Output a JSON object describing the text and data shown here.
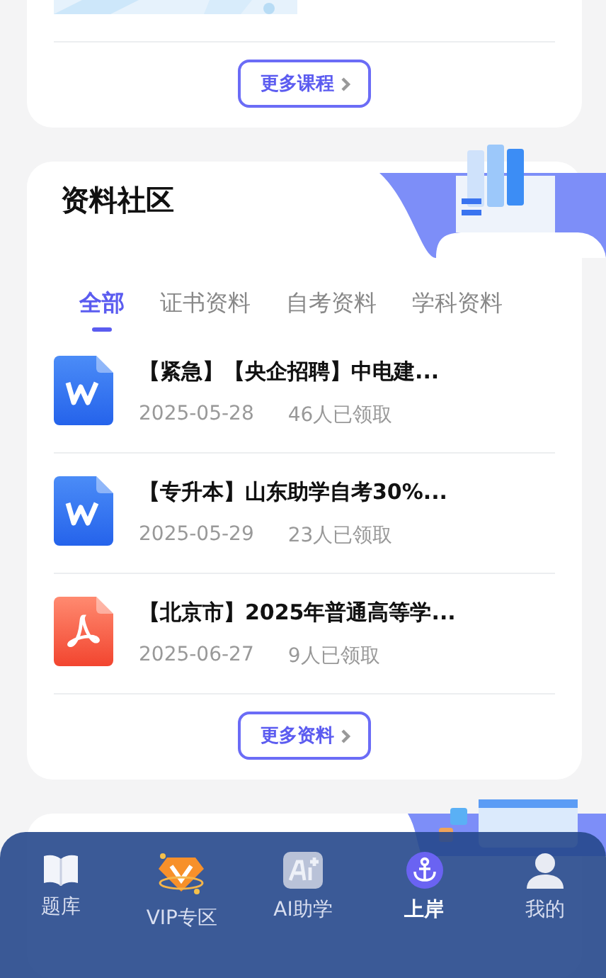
{
  "course_card": {
    "more_button": "更多课程"
  },
  "materials": {
    "title": "资料社区",
    "tabs": [
      {
        "label": "全部",
        "selected": true
      },
      {
        "label": "证书资料",
        "selected": false
      },
      {
        "label": "自考资料",
        "selected": false
      },
      {
        "label": "学科资料",
        "selected": false
      }
    ],
    "items": [
      {
        "kind": "word",
        "title": "【紧急】【央企招聘】中电建...",
        "date": "2025-05-28",
        "claimed": "46人已领取"
      },
      {
        "kind": "word",
        "title": "【专升本】山东助学自考30%...",
        "date": "2025-05-29",
        "claimed": "23人已领取"
      },
      {
        "kind": "pdf",
        "title": "【北京市】2025年普通高等学...",
        "date": "2025-06-27",
        "claimed": "9人已领取"
      }
    ],
    "more_button": "更多资料"
  },
  "bottom_nav": [
    {
      "kind": "book",
      "label": "题库",
      "selected": false
    },
    {
      "kind": "vip",
      "label": "VIP专区",
      "selected": false
    },
    {
      "kind": "ai",
      "label": "AI助学",
      "selected": false
    },
    {
      "kind": "anchor",
      "label": "上岸",
      "selected": true
    },
    {
      "kind": "user",
      "label": "我的",
      "selected": false
    }
  ]
}
